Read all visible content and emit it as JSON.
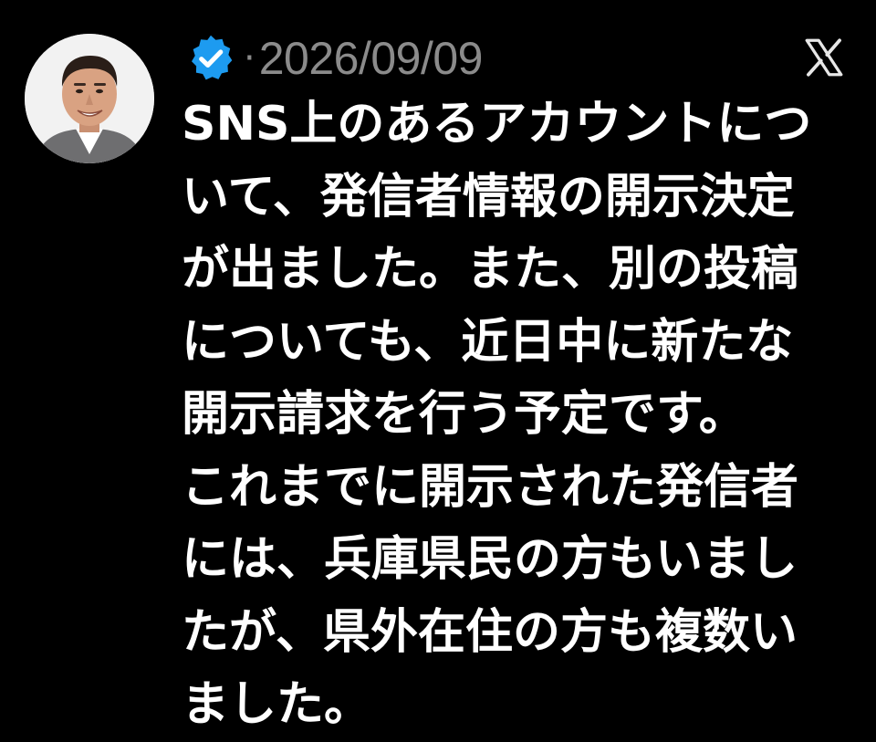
{
  "post": {
    "author_avatar_icon": "profile-photo",
    "verified_badge_icon": "verified-checkmark-icon",
    "verified_badge_color": "#1d9bf0",
    "separator": "·",
    "timestamp": "2026/09/09",
    "platform_logo_icon": "x-logo-icon",
    "text_lines": [
      "SNS上のあるアカウントにつ",
      "いて、発信者情報の開示決定",
      "が出ました。また、別の投稿",
      "についても、近日中に新たな",
      "開示請求を行う予定です。",
      "これまでに開示された発信者",
      "には、兵庫県民の方もいまし",
      "たが、県外在住の方も複数い",
      "ました。"
    ]
  },
  "colors": {
    "background": "#000000",
    "text": "#ffffff",
    "muted": "#8b8b8b"
  }
}
